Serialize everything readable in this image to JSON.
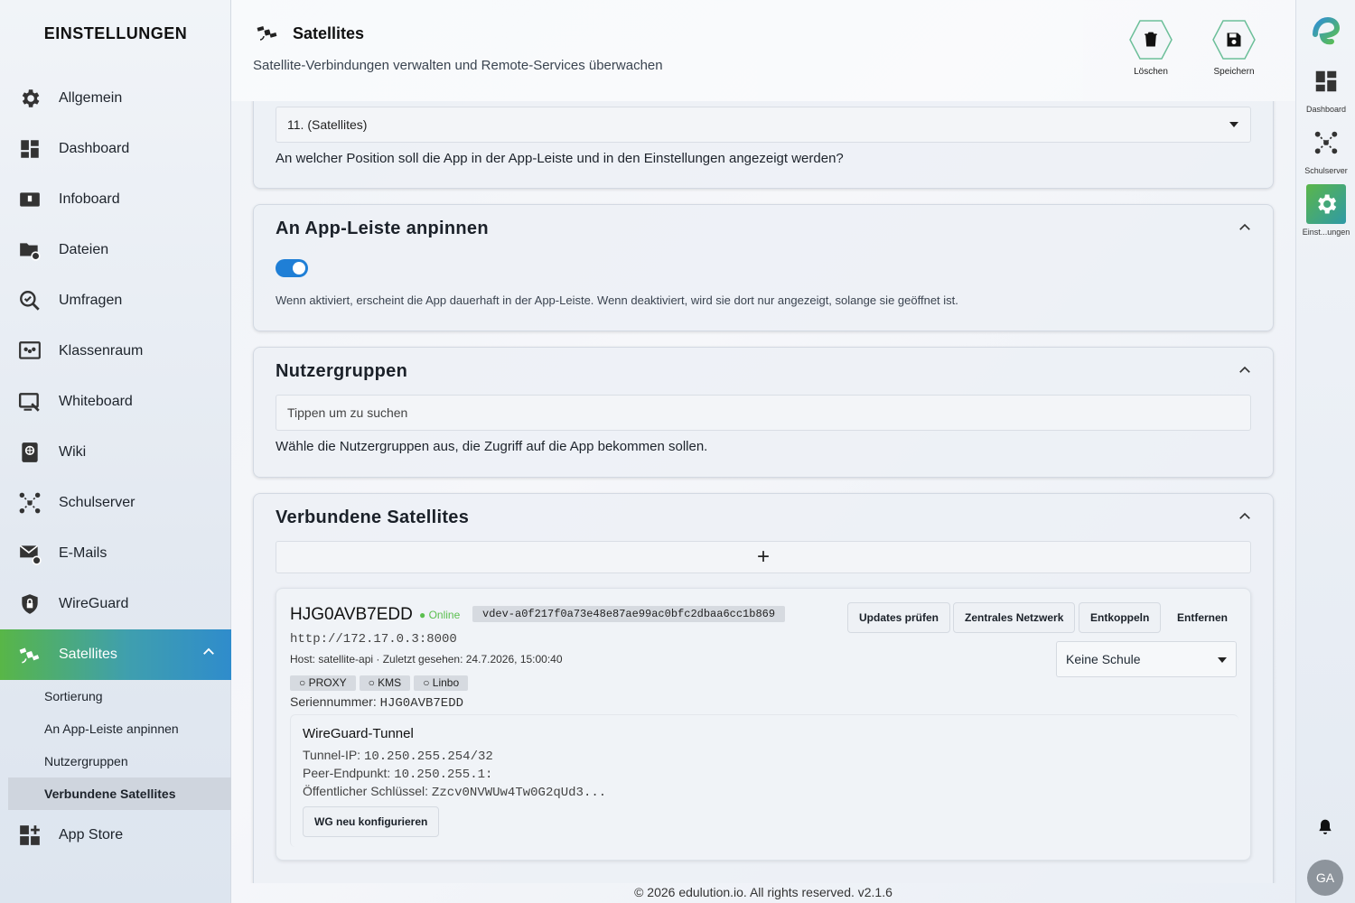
{
  "sidebar": {
    "title": "EINSTELLUNGEN",
    "items": [
      {
        "label": "Allgemein"
      },
      {
        "label": "Dashboard"
      },
      {
        "label": "Infoboard"
      },
      {
        "label": "Dateien"
      },
      {
        "label": "Umfragen"
      },
      {
        "label": "Klassenraum"
      },
      {
        "label": "Whiteboard"
      },
      {
        "label": "Wiki"
      },
      {
        "label": "Schulserver"
      },
      {
        "label": "E-Mails"
      },
      {
        "label": "WireGuard"
      },
      {
        "label": "Satellites"
      },
      {
        "label": "App Store"
      }
    ],
    "sub_items": [
      {
        "label": "Sortierung"
      },
      {
        "label": "An App-Leiste anpinnen"
      },
      {
        "label": "Nutzergruppen"
      },
      {
        "label": "Verbundene Satellites"
      }
    ],
    "accent_gradient": [
      "#58b647",
      "#2f8ccc"
    ]
  },
  "header": {
    "title": "Satellites",
    "subtitle": "Satellite-Verbindungen verwalten und Remote-Services überwachen",
    "delete_label": "Löschen",
    "save_label": "Speichern"
  },
  "sorting": {
    "selected": "11. (Satellites)",
    "helper": "An welcher Position soll die App in der App-Leiste und in den Einstellungen angezeigt werden?"
  },
  "pin": {
    "title": "An App-Leiste anpinnen",
    "enabled": true,
    "helper": "Wenn aktiviert, erscheint die App dauerhaft in der App-Leiste. Wenn deaktiviert, wird sie dort nur angezeigt, solange sie geöffnet ist."
  },
  "groups": {
    "title": "Nutzergruppen",
    "placeholder": "Tippen um zu suchen",
    "helper": "Wähle die Nutzergruppen aus, die Zugriff auf die App bekommen sollen."
  },
  "satellites": {
    "title": "Verbundene Satellites",
    "add_symbol": "+",
    "entry": {
      "name": "HJG0AVB7EDD",
      "status": "Online",
      "status_color": "#5bbf4f",
      "device_id": "vdev-a0f217f0a73e48e87ae99ac0bfc2dbaa6cc1b869",
      "url": "http://172.17.0.3:8000",
      "host_line": "Host: satellite-api · Zuletzt gesehen: 24.7.2026, 15:00:40",
      "services": [
        "○ PROXY",
        "○ KMS",
        "○ Linbo"
      ],
      "serial_label": "Seriennummer:",
      "serial_value": "HJG0AVB7EDD",
      "buttons": {
        "check_updates": "Updates prüfen",
        "central_network": "Zentrales Netzwerk",
        "unlink": "Entkoppeln",
        "remove": "Entfernen"
      },
      "school_select": "Keine Schule",
      "wireguard": {
        "title": "WireGuard-Tunnel",
        "tunnel_ip_label": "Tunnel-IP:",
        "tunnel_ip": "10.250.255.254/32",
        "peer_label": "Peer-Endpunkt:",
        "peer": "10.250.255.1:",
        "pubkey_label": "Öffentlicher Schlüssel:",
        "pubkey": "Zzcv0NVWUw4Tw0G2qUd3...",
        "reconfigure": "WG neu konfigurieren"
      }
    }
  },
  "rail": {
    "apps": [
      {
        "label": "Dashboard"
      },
      {
        "label": "Schulserver"
      },
      {
        "label": "Einst...ungen"
      }
    ],
    "avatar": "GA"
  },
  "footer": "© 2026 edulution.io. All rights reserved. v2.1.6"
}
